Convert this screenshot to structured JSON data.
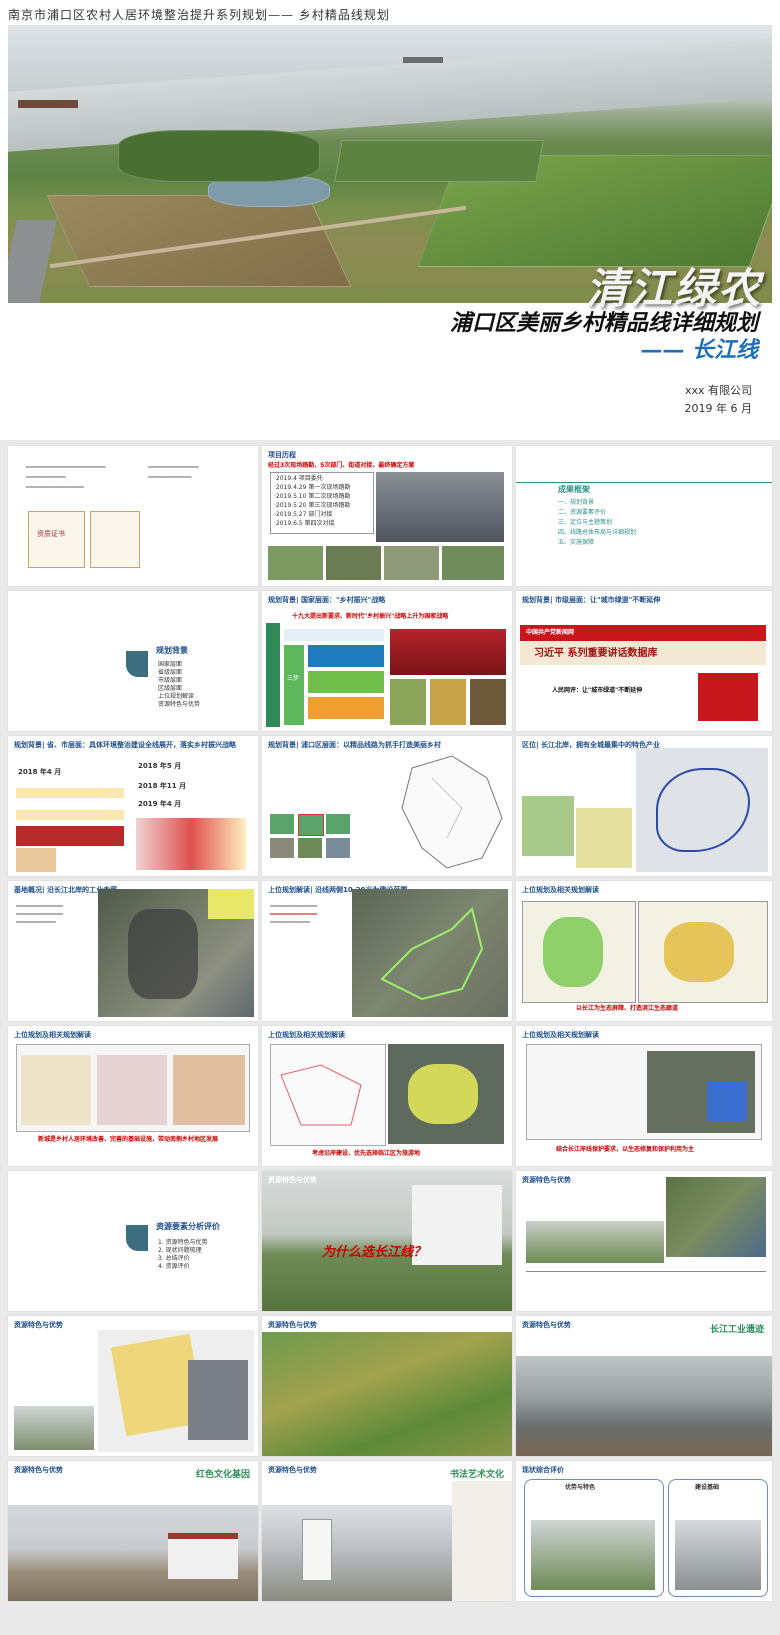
{
  "hero": {
    "top_title": "南京市浦口区农村人居环境整治提升系列规划—— 乡村精品线规划",
    "main_title": "清江绿农",
    "subtitle": "浦口区美丽乡村精品线详细规划",
    "line_name": "—— 长江线",
    "company": "xxx 有限公司",
    "date": "2019 年 6 月"
  },
  "slides": {
    "s1": {
      "cert": "资质证书"
    },
    "s2": {
      "title": "项目历程",
      "sub": "经过3次现场踏勘、5次部门、街道对接，最终确定方案",
      "timeline": [
        "·2019.4  项目委托",
        "·2019.4.29  第一次现场踏勘",
        "·2019.5.10  第二次现场踏勘",
        "·2019.5.20  第三次现场踏勘",
        "·2019.5.27  部门对接",
        "·2019.6.5  第四次对接"
      ]
    },
    "s3": {
      "heading": "成果框架",
      "items": [
        "一、规划背景",
        "二、资源要素评价",
        "三、定位与主题策划",
        "四、线路总体布局与详细规划",
        "五、实施保障"
      ]
    },
    "s4": {
      "heading": "规划背景",
      "items": [
        "国家层面",
        "省级层面",
        "市级层面",
        "区级层面",
        "上位规划解读",
        "资源特色与优势"
      ]
    },
    "s5": {
      "title": "规划背景| 国家层面：\"乡村振兴\"战略",
      "sub": "十九大提出新要求、新时代\"乡村振兴\"战略上升为国家战略",
      "block": "乡村振兴战略的总体目标",
      "step": "三步"
    },
    "s6": {
      "title": "规划背景| 市级层面：让\"城市绿道\"不断延伸",
      "banner": "中国共产党新闻网",
      "banner_big": "习近平 系列重要讲话数据库",
      "caption": "人民网评：让\"城市绿道\"不断延伸"
    },
    "s7": {
      "title": "规划背景| 省、市层面：具体环境整治建设全线展开，落实乡村振兴战略",
      "date1": "2018 年4 月",
      "date2": "2018 年5 月",
      "date3": "2018 年11 月",
      "date4": "2019 年4 月"
    },
    "s8": {
      "title": "规划背景| 浦口区层面：以精品线路为抓手打造美丽乡村"
    },
    "s9": {
      "title": "区位| 长江北岸，拥有全城最集中的特色产业"
    },
    "s10": {
      "title": "基地概况| 沿长江北岸的工业走廊"
    },
    "s11": {
      "title": "上位规划解读| 沿线两侧10-20米为建设范围"
    },
    "s12": {
      "title": "上位规划及相关规划解读",
      "caption": "以长江为生态屏障、打造滨江生态廊道"
    },
    "s13": {
      "title": "上位规划及相关规划解读",
      "caption": "新城是乡村人居环境改善、完善的基础设施，带动南侧乡村地区发展"
    },
    "s14": {
      "title": "上位规划及相关规划解读",
      "caption": "考虑沿岸建设、优先选择临江区为旅游地"
    },
    "s15": {
      "title": "上位规划及相关规划解读",
      "caption": "结合长江岸线保护要求，以生态修复和保护利用为主"
    },
    "s16": {
      "heading": "资源要素分析评价",
      "items": [
        "1. 资源特色与优势",
        "2. 现状问题梳理",
        "3. 总结评价",
        "4. 资源评价"
      ]
    },
    "s17": {
      "title": "资源特色与优势",
      "big": "为什么选长江线？"
    },
    "s18": {
      "title": "资源特色与优势"
    },
    "s19": {
      "title": "资源特色与优势"
    },
    "s20": {
      "title": "资源特色与优势"
    },
    "s21": {
      "title": "资源特色与优势",
      "tag": "长江工业遗迹"
    },
    "s22": {
      "title": "资源特色与优势",
      "tag": "红色文化基因"
    },
    "s23": {
      "title": "资源特色与优势",
      "tag": "书法艺术文化"
    },
    "s24": {
      "title": "现状综合评价",
      "box1": "优势与特色",
      "box2": "建设基础"
    }
  }
}
